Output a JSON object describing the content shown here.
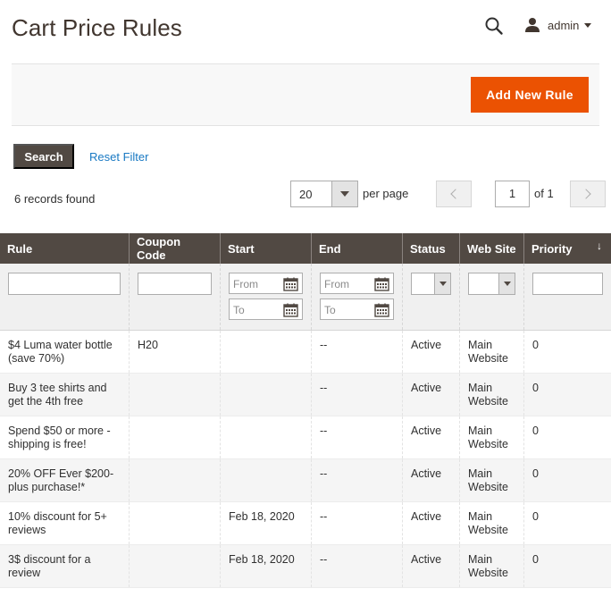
{
  "header": {
    "title": "Cart Price Rules",
    "admin_label": "admin"
  },
  "actions": {
    "add_new_label": "Add New Rule"
  },
  "toolbar": {
    "search_label": "Search",
    "reset_filter_label": "Reset Filter",
    "records_found": "6 records found",
    "per_page_value": "20",
    "per_page_label": "per page",
    "current_page": "1",
    "page_of": "of 1"
  },
  "grid": {
    "columns": {
      "rule": "Rule",
      "coupon": "Coupon Code",
      "start": "Start",
      "end": "End",
      "status": "Status",
      "website": "Web Site",
      "priority": "Priority"
    },
    "sort_indicator": "↓",
    "filters": {
      "from_placeholder": "From",
      "to_placeholder": "To"
    },
    "rows": [
      {
        "rule": "$4 Luma water bottle (save 70%)",
        "coupon": "H20",
        "start": "",
        "end": "--",
        "status": "Active",
        "website": "Main Website",
        "priority": "0"
      },
      {
        "rule": "Buy 3 tee shirts and get the 4th free",
        "coupon": "",
        "start": "",
        "end": "--",
        "status": "Active",
        "website": "Main Website",
        "priority": "0"
      },
      {
        "rule": "Spend $50 or more - shipping is free!",
        "coupon": "",
        "start": "",
        "end": "--",
        "status": "Active",
        "website": "Main Website",
        "priority": "0"
      },
      {
        "rule": "20% OFF Ever $200-plus purchase!*",
        "coupon": "",
        "start": "",
        "end": "--",
        "status": "Active",
        "website": "Main Website",
        "priority": "0"
      },
      {
        "rule": "10% discount for 5+ reviews",
        "coupon": "",
        "start": "Feb 18, 2020",
        "end": "--",
        "status": "Active",
        "website": "Main Website",
        "priority": "0"
      },
      {
        "rule": "3$ discount for a review",
        "coupon": "",
        "start": "Feb 18, 2020",
        "end": "--",
        "status": "Active",
        "website": "Main Website",
        "priority": "0"
      }
    ]
  },
  "icons": {
    "search": "search-icon",
    "user": "user-icon",
    "calendar": "calendar-icon"
  },
  "colors": {
    "accent": "#eb5202",
    "header_bg": "#514943",
    "link": "#1979c3"
  }
}
